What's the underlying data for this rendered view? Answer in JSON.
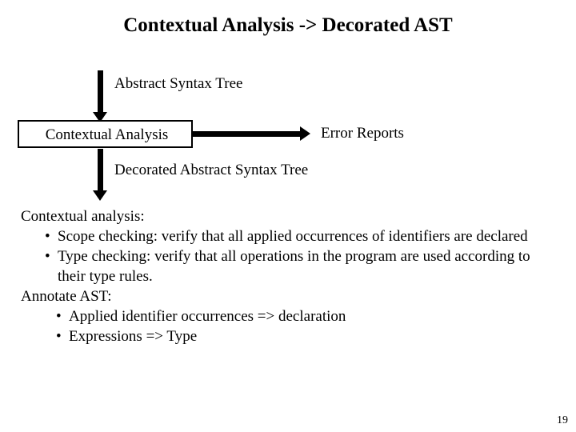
{
  "slide": {
    "title": "Contextual Analysis -> Decorated AST",
    "page_number": "19"
  },
  "diagram": {
    "input_label": "Abstract Syntax Tree",
    "process_box_label": "Contextual Analysis",
    "side_output_label": "Error Reports",
    "output_label": "Decorated Abstract Syntax Tree"
  },
  "content": {
    "lead": "Contextual analysis:",
    "bullets": [
      {
        "marker": "•",
        "text": "Scope checking: verify that all applied occurrences of identifiers are declared",
        "indent": 1
      },
      {
        "marker": "•",
        "text": "Type checking: verify that all operations in the program are used according to their type rules.",
        "indent": 1
      }
    ],
    "annotate_heading": "Annotate AST:",
    "annotate_bullets": [
      {
        "marker": "•",
        "text": "Applied identifier occurrences => declaration",
        "indent": 2
      },
      {
        "marker": "•",
        "text": "Expressions => Type",
        "indent": 2
      }
    ]
  }
}
